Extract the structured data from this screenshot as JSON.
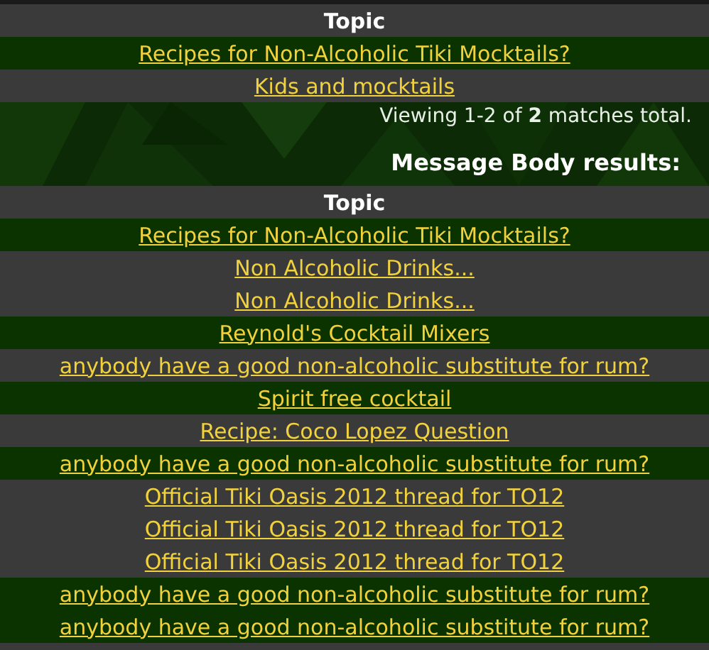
{
  "title_results": {
    "header": "Topic",
    "rows": [
      {
        "text": "Recipes for Non-Alcoholic Tiki Mocktails?",
        "kind": "green"
      },
      {
        "text": "Kids and mocktails",
        "kind": "gray"
      }
    ]
  },
  "summary": "Viewing 1-2 of **2** matches total.",
  "body_heading": "Message Body results:",
  "body_results": {
    "header": "Topic",
    "rows": [
      {
        "text": "Recipes for Non-Alcoholic Tiki Mocktails?",
        "kind": "green"
      },
      {
        "text": "Non Alcoholic Drinks...",
        "kind": "gray"
      },
      {
        "text": "Non Alcoholic Drinks...",
        "kind": "gray"
      },
      {
        "text": "Reynold's Cocktail Mixers",
        "kind": "green"
      },
      {
        "text": "anybody have a good non-alcoholic substitute for rum?",
        "kind": "gray"
      },
      {
        "text": "Spirit free cocktail",
        "kind": "green"
      },
      {
        "text": "Recipe: Coco Lopez Question",
        "kind": "gray"
      },
      {
        "text": "anybody have a good non-alcoholic substitute for rum?",
        "kind": "green"
      },
      {
        "text": "Official Tiki Oasis 2012 thread for TO12",
        "kind": "gray"
      },
      {
        "text": "Official Tiki Oasis 2012 thread for TO12",
        "kind": "gray"
      },
      {
        "text": "Official Tiki Oasis 2012 thread for TO12",
        "kind": "gray"
      },
      {
        "text": "anybody have a good non-alcoholic substitute for rum?",
        "kind": "green"
      },
      {
        "text": "anybody have a good non-alcoholic substitute for rum?",
        "kind": "green"
      }
    ]
  }
}
